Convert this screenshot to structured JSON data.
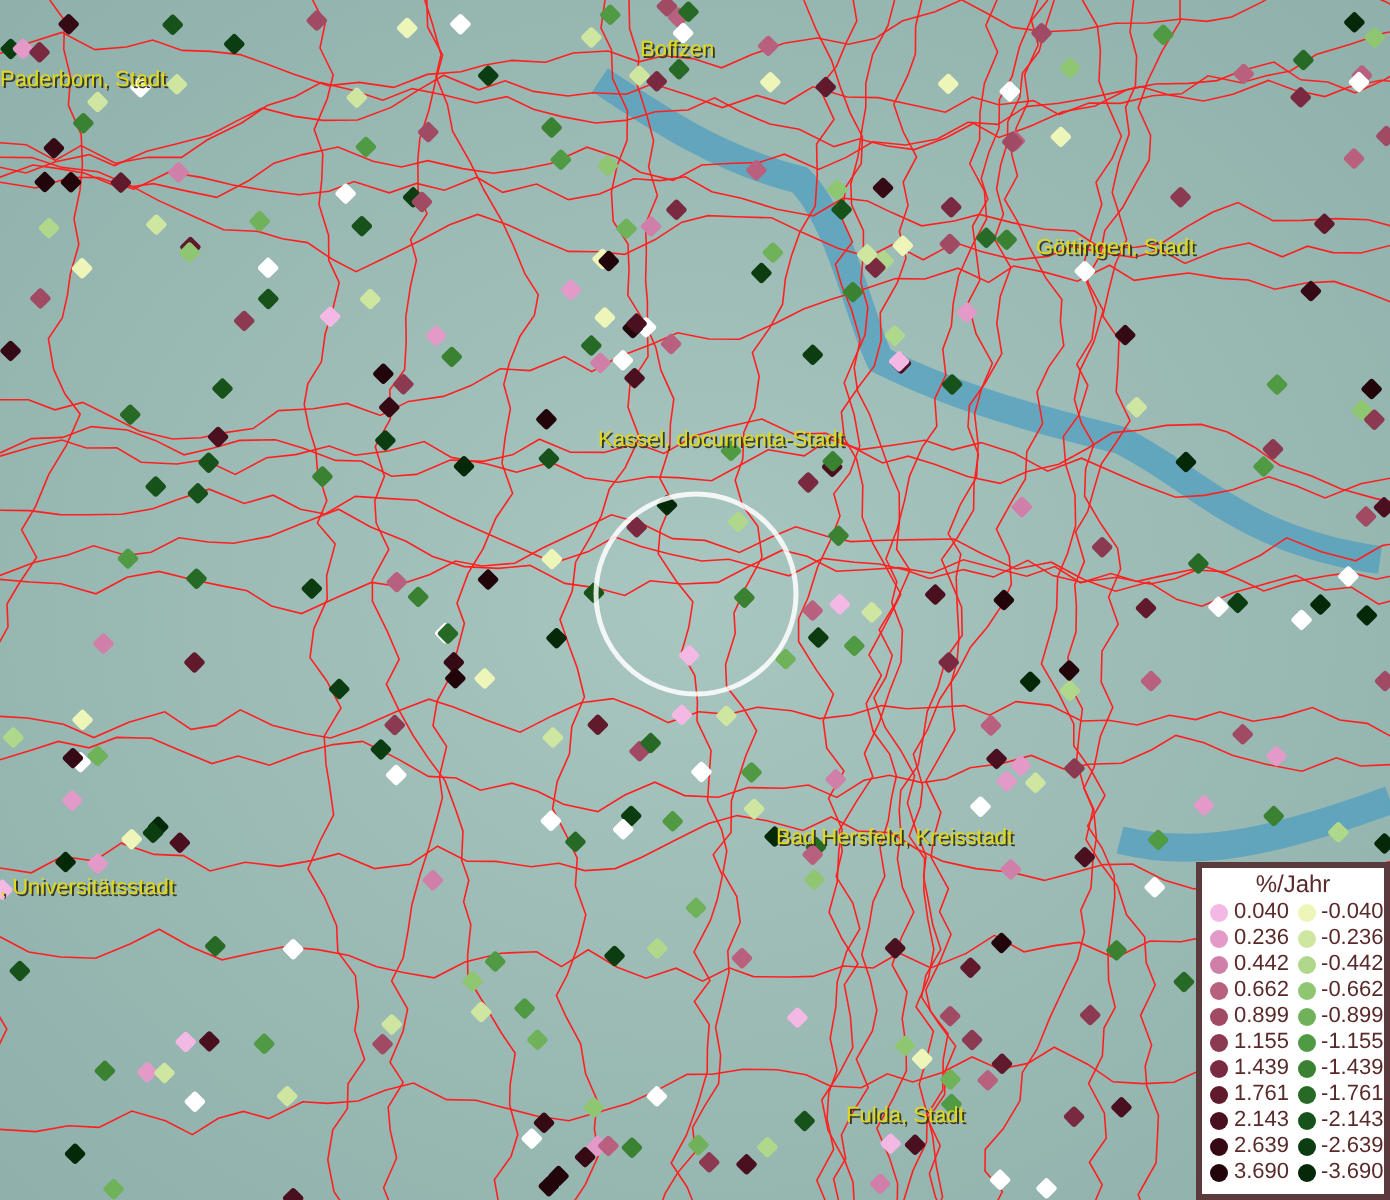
{
  "map": {
    "labels": [
      {
        "text": "Paderborn, Stadt"
      },
      {
        "text": "Boffzen"
      },
      {
        "text": "Göttingen, Stadt"
      },
      {
        "text": "Kassel, documenta-Stadt"
      },
      {
        "text": ", Universitätsstadt"
      },
      {
        "text": "Bad Hersfeld, Kreisstadt"
      },
      {
        "text": "Fulda, Stadt"
      }
    ]
  },
  "legend": {
    "title": "%/Jahr",
    "columns": [
      {
        "entries": [
          {
            "label": "0.040",
            "color": "#f4b8e4"
          },
          {
            "label": "0.236",
            "color": "#e49ac8"
          },
          {
            "label": "0.442",
            "color": "#d07fa8"
          },
          {
            "label": "0.662",
            "color": "#b8607e"
          },
          {
            "label": "0.899",
            "color": "#a04a63"
          },
          {
            "label": "1.155",
            "color": "#8c3a52"
          },
          {
            "label": "1.439",
            "color": "#7a2a40"
          },
          {
            "label": "1.761",
            "color": "#611a2c"
          },
          {
            "label": "2.143",
            "color": "#4a1020"
          },
          {
            "label": "2.639",
            "color": "#360a15"
          },
          {
            "label": "3.690",
            "color": "#22050b"
          }
        ]
      },
      {
        "entries": [
          {
            "label": "-0.040",
            "color": "#eef5b8"
          },
          {
            "label": "-0.236",
            "color": "#cfe6a0"
          },
          {
            "label": "-0.442",
            "color": "#b0d88a"
          },
          {
            "label": "-0.662",
            "color": "#8fc671"
          },
          {
            "label": "-0.899",
            "color": "#6fb25a"
          },
          {
            "label": "-1.155",
            "color": "#519a44"
          },
          {
            "label": "-1.439",
            "color": "#3a8232"
          },
          {
            "label": "-1.761",
            "color": "#276a25"
          },
          {
            "label": "-2.143",
            "color": "#17521a"
          },
          {
            "label": "-2.639",
            "color": "#0c3d10"
          },
          {
            "label": "-3.690",
            "color": "#052808"
          }
        ]
      }
    ]
  }
}
